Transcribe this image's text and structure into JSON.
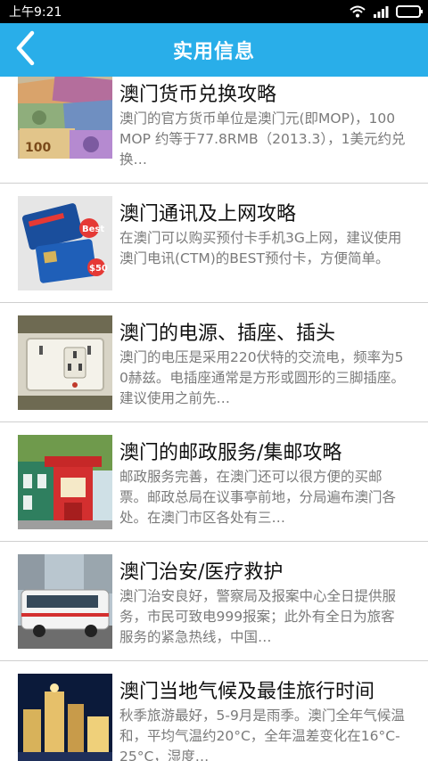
{
  "status_bar": {
    "time": "上午9:21",
    "icons": [
      "wifi-icon",
      "signal-icon",
      "battery-icon"
    ],
    "battery_color": "#2ecc40"
  },
  "header": {
    "title": "实用信息",
    "back_icon": "chevron-left-icon",
    "color": "#29aee9"
  },
  "items": [
    {
      "title": "澳门货币兑换攻略",
      "desc": "澳门的官方货币单位是澳门元(即MOP)，100MOP 约等于77.8RMB（2013.3），1美元约兑换…",
      "thumb": "currency-banknotes"
    },
    {
      "title": "澳门通讯及上网攻略",
      "desc": "在澳门可以购买预付卡手机3G上网，建议使用澳门电讯(CTM)的BEST预付卡，方便简单。",
      "thumb": "ctm-sim-cards"
    },
    {
      "title": "澳门的电源、插座、插头",
      "desc": "澳门的电压是采用220伏特的交流电，频率为50赫兹。电插座通常是方形或圆形的三脚插座。建议使用之前先…",
      "thumb": "power-socket"
    },
    {
      "title": "澳门的邮政服务/集邮攻略",
      "desc": "邮政服务完善，在澳门还可以很方便的买邮票。邮政总局在议事亭前地，分局遍布澳门各处。在澳门市区各处有三…",
      "thumb": "post-office-kiosk"
    },
    {
      "title": "澳门治安/医疗救护",
      "desc": "澳门治安良好，警察局及报案中心全日提供服务，市民可致电999报案；此外有全日为旅客服务的紧急热线，中国…",
      "thumb": "ambulance-bus"
    },
    {
      "title": "澳门当地气候及最佳旅行时间",
      "desc": "秋季旅游最好，5-9月是雨季。澳门全年气候温和，平均气温约20°C，全年温差变化在16°C-25°C，湿度…",
      "thumb": "night-skyline"
    }
  ]
}
